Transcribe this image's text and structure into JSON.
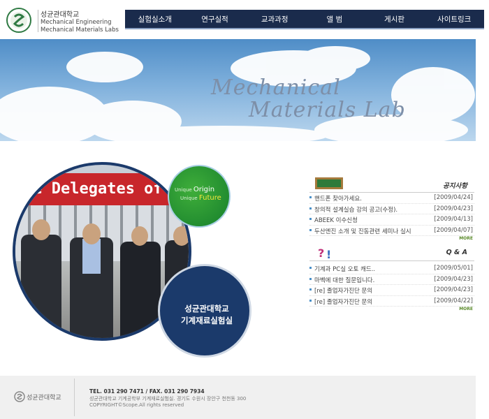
{
  "header": {
    "logo_univ": "성균관대학교",
    "logo_line1": "Mechanical Engineering",
    "logo_line2": "Mechanical Materials Labs"
  },
  "nav": {
    "items": [
      "실험실소개",
      "연구실적",
      "교과과정",
      "앨 범",
      "게시판",
      "사이트링크"
    ]
  },
  "banner": {
    "line1": "Mechanical",
    "line2": "Materials Lab"
  },
  "photo": {
    "banner_text": "ne Delegates of K"
  },
  "origin": {
    "unique1": "Unique ",
    "word1": "Origin",
    "unique2": "Unique ",
    "word2": "Future"
  },
  "lab": {
    "line1": "성균관대학교",
    "line2": "기계재료실험실"
  },
  "notice": {
    "title": "공지사항",
    "more": "MORE",
    "items": [
      {
        "title": "핸드폰 찾아가세요.",
        "date": "[2009/04/24]"
      },
      {
        "title": "창의적 설계실습 강의 공고(수정).",
        "date": "[2009/04/23]"
      },
      {
        "title": "ABEEK 이수신청",
        "date": "[2009/04/13]"
      },
      {
        "title": "두산엔진 소개 및 진동관련 세미나 실시",
        "date": "[2009/04/07]"
      }
    ]
  },
  "qa": {
    "title": "Q & A",
    "more": "MORE",
    "items": [
      {
        "title": "기계과 PC실 오토 캐드..",
        "date": "[2009/05/01]"
      },
      {
        "title": "마벡에 대한 질문입니다.",
        "date": "[2009/04/23]"
      },
      {
        "title": "[re] 졸업자가진단 문의",
        "date": "[2009/04/23]"
      },
      {
        "title": "[re] 졸업자가진단 문의",
        "date": "[2009/04/22]"
      }
    ]
  },
  "footer": {
    "logo_text": "성균관대학교",
    "tel": "TEL. 031 290 7471 / FAX. 031 290 7934",
    "address": "성균관대학교 기계공학부 기계재료실험실. 경기도 수원시 장안구 천천동 300",
    "copyright": "COPYRIGHT©Scope.All rights reserved"
  },
  "colors": {
    "nav_bg": "#1a2b4c",
    "lab_circle": "#1b3a6b",
    "origin_green": "#167f2c",
    "bullet_blue": "#4a90c8"
  }
}
